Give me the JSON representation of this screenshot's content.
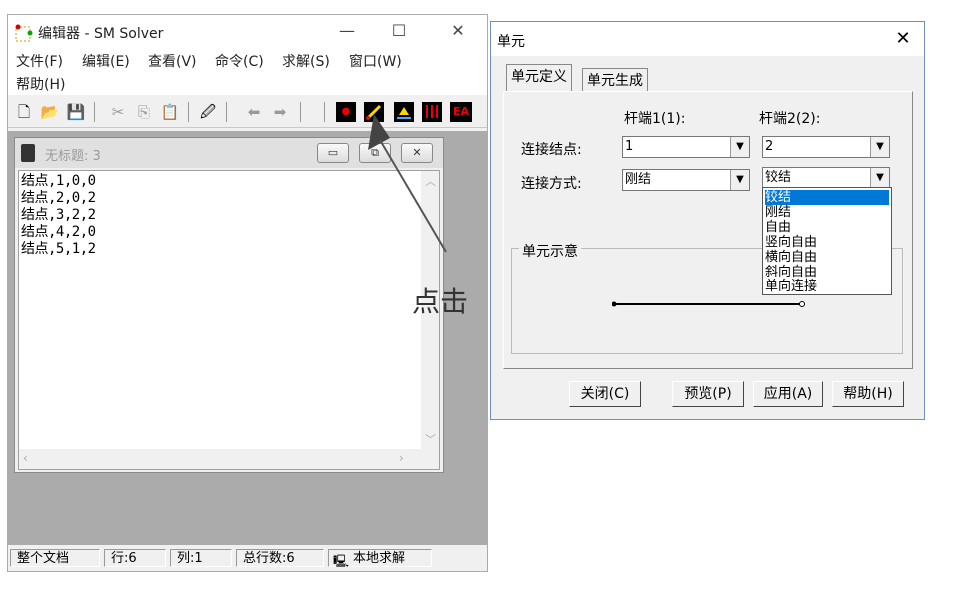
{
  "editor": {
    "title": "编辑器 - SM Solver",
    "menu": [
      "文件(F)",
      "编辑(E)",
      "查看(V)",
      "命令(C)",
      "求解(S)",
      "窗口(W)",
      "帮助(H)"
    ],
    "toolbar_labels": {
      "ea": "EA"
    },
    "child": {
      "title": "无标题: 3",
      "lines": [
        "结点,1,0,0",
        "结点,2,0,2",
        "结点,3,2,2",
        "结点,4,2,0",
        "结点,5,1,2"
      ]
    },
    "status": [
      "整个文档",
      "行:6",
      "列:1",
      "总行数:6",
      "本地求解"
    ]
  },
  "annotation": {
    "click": "点击"
  },
  "dialog": {
    "title": "单元",
    "tabs": [
      "单元定义",
      "单元生成"
    ],
    "end1_header": "杆端1(1):",
    "end2_header": "杆端2(2):",
    "node_label": "连接结点:",
    "mode_label": "连接方式:",
    "end1_node": "1",
    "end2_node": "2",
    "end1_mode": "刚结",
    "end2_mode": "铰结",
    "options": [
      "铰结",
      "刚结",
      "自由",
      "竖向自由",
      "横向自由",
      "斜向自由",
      "单向连接"
    ],
    "selected_option": 0,
    "preview_label": "单元示意",
    "buttons": [
      "关闭(C)",
      "预览(P)",
      "应用(A)",
      "帮助(H)"
    ]
  },
  "colors": {
    "selection": "#0078d7",
    "mdi_bg": "#ababab"
  }
}
